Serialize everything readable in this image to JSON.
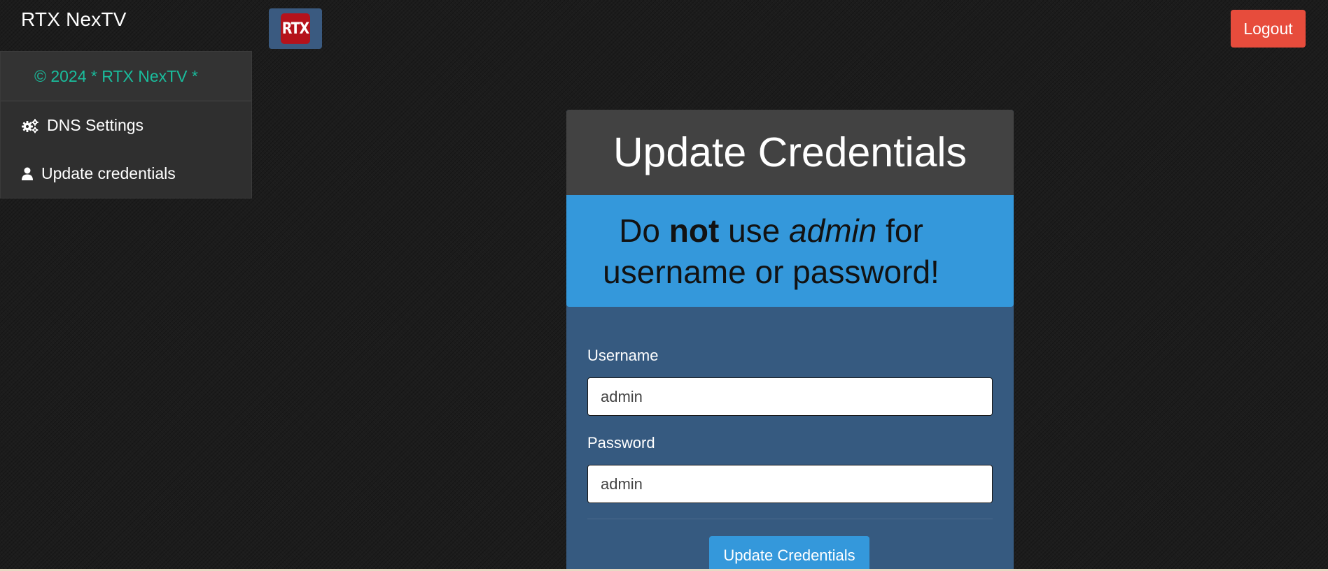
{
  "brand": {
    "name": "RTX NexTV",
    "logo_text": "RTX"
  },
  "header": {
    "logout_label": "Logout"
  },
  "sidebar": {
    "copyright": "© 2024 *  RTX NexTV  *",
    "items": [
      {
        "label": "DNS Settings",
        "icon": "gears-icon"
      },
      {
        "label": "Update credentials",
        "icon": "user-icon"
      }
    ]
  },
  "panel": {
    "title": "Update Credentials",
    "alert": {
      "part1": "Do ",
      "bold": "not",
      "part2": " use ",
      "italic": "admin",
      "part3": " for",
      "line2": "username or password!"
    },
    "username": {
      "label": "Username",
      "value": "admin"
    },
    "password": {
      "label": "Password",
      "value": "admin"
    },
    "submit_label": "Update Credentials"
  },
  "colors": {
    "logout": "#e74c3c",
    "alert": "#3498db",
    "panel": "#365a80",
    "copyright": "#1abc9c"
  }
}
